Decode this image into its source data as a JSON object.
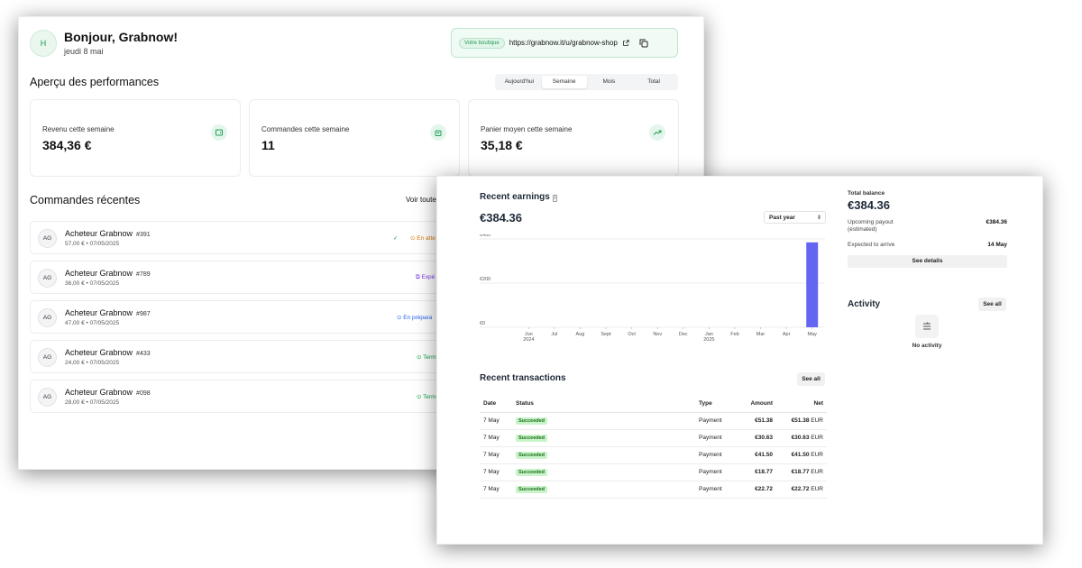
{
  "dashboard": {
    "avatar_initial": "H",
    "greeting": "Bonjour, Grabnow!",
    "date": "jeudi 8 mai",
    "shop": {
      "badge": "Votre boutique",
      "url": "https://grabnow.it/u/grabnow-shop"
    },
    "performance_title": "Aperçu des performances",
    "periods": [
      "Aujourd'hui",
      "Semaine",
      "Mois",
      "Total"
    ],
    "active_period": "Semaine",
    "stats": [
      {
        "label": "Revenu cette semaine",
        "value": "384,36 €",
        "icon": "wallet-icon"
      },
      {
        "label": "Commandes cette semaine",
        "value": "11",
        "icon": "shopping-bag-icon"
      },
      {
        "label": "Panier moyen cette semaine",
        "value": "35,18 €",
        "icon": "trending-up-icon"
      }
    ],
    "recent_title": "Commandes récentes",
    "see_all": "Voir toute",
    "orders": [
      {
        "initials": "AG",
        "name": "Acheteur Grabnow",
        "id": "#391",
        "sub": "57,00 € • 07/05/2025",
        "status": "En atte",
        "status_color": "#d97706"
      },
      {
        "initials": "AG",
        "name": "Acheteur Grabnow",
        "id": "#789",
        "sub": "36,00 € • 07/05/2025",
        "status": "Expé",
        "status_color": "#7c3aed"
      },
      {
        "initials": "AG",
        "name": "Acheteur Grabnow",
        "id": "#987",
        "sub": "47,00 € • 07/05/2025",
        "status": "En prépara",
        "status_color": "#2563eb"
      },
      {
        "initials": "AG",
        "name": "Acheteur Grabnow",
        "id": "#433",
        "sub": "24,00 € • 07/05/2025",
        "status": "Term",
        "status_color": "#16a34a"
      },
      {
        "initials": "AG",
        "name": "Acheteur Grabnow",
        "id": "#098",
        "sub": "28,00 € • 07/05/2025",
        "status": "Term",
        "status_color": "#16a34a"
      }
    ]
  },
  "earnings": {
    "title": "Recent earnings",
    "amount": "€384.36",
    "range_select": "Past year",
    "chart_data": {
      "type": "bar",
      "categories": [
        "Jun 2024",
        "Jul",
        "Aug",
        "Sept",
        "Oct",
        "Nov",
        "Dec",
        "Jan 2025",
        "Feb",
        "Mar",
        "Apr",
        "May"
      ],
      "tick_labels": [
        [
          "Jun",
          "2024"
        ],
        [
          "Jul"
        ],
        [
          "Aug"
        ],
        [
          "Sept"
        ],
        [
          "Oct"
        ],
        [
          "Nov"
        ],
        [
          "Dec"
        ],
        [
          "Jan",
          "2025"
        ],
        [
          "Feb"
        ],
        [
          "Mar"
        ],
        [
          "Apr"
        ],
        [
          "May"
        ]
      ],
      "values": [
        0,
        0,
        0,
        0,
        0,
        0,
        0,
        0,
        0,
        0,
        0,
        384.36
      ],
      "y_ticks": [
        "€400",
        "€200",
        "€0"
      ],
      "ylim": [
        0,
        400
      ],
      "bar_color": "#6366f1",
      "grid": true
    },
    "transactions_title": "Recent transactions",
    "see_all": "See all",
    "columns": [
      "Date",
      "Status",
      "Type",
      "Amount",
      "Net"
    ],
    "transactions": [
      {
        "date": "7 May",
        "status": "Succeeded",
        "type": "Payment",
        "amount": "€51.38",
        "net": "€51.38",
        "currency": "EUR"
      },
      {
        "date": "7 May",
        "status": "Succeeded",
        "type": "Payment",
        "amount": "€30.63",
        "net": "€30.63",
        "currency": "EUR"
      },
      {
        "date": "7 May",
        "status": "Succeeded",
        "type": "Payment",
        "amount": "€41.50",
        "net": "€41.50",
        "currency": "EUR"
      },
      {
        "date": "7 May",
        "status": "Succeeded",
        "type": "Payment",
        "amount": "€18.77",
        "net": "€18.77",
        "currency": "EUR"
      },
      {
        "date": "7 May",
        "status": "Succeeded",
        "type": "Payment",
        "amount": "€22.72",
        "net": "€22.72",
        "currency": "EUR"
      }
    ],
    "balance": {
      "label": "Total balance",
      "value": "€384.36",
      "payout_label": "Upcoming payout (estimated)",
      "payout_value": "€384.36",
      "arrive_label": "Expected to arrive",
      "arrive_value": "14 May",
      "details_btn": "See details"
    },
    "activity": {
      "title": "Activity",
      "see_all": "See all",
      "empty": "No activity"
    }
  },
  "colors": {
    "accent_green": "#1f9d55",
    "bar": "#6366f1",
    "success_pill": "#c9f3c9"
  }
}
